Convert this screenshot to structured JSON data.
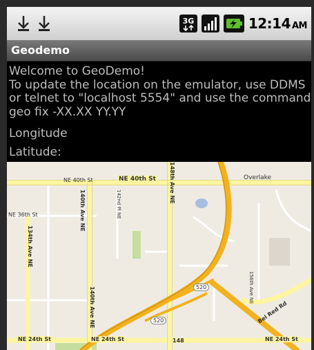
{
  "status_bar": {
    "time": "12:14",
    "ampm": "AM",
    "network_badge": "3G",
    "icons": [
      "download-icon",
      "download-icon",
      "network-3g-icon",
      "signal-icon",
      "battery-charging-icon"
    ]
  },
  "app": {
    "title": "Geodemo"
  },
  "content": {
    "welcome_line1": "Welcome to GeoDemo!",
    "welcome_line2": "To update the location on the emulator, use DDMS",
    "welcome_line3": "or telnet to \"localhost 5554\" and use the command",
    "welcome_line4": "geo fix -XX.XX YY.YY",
    "longitude_label": "Longitude",
    "latitude_label": "Latitude:"
  },
  "map": {
    "labels": {
      "ne40_left": "NE 40th St",
      "ne40_right": "NE 40th St",
      "ne36": "NE 36th St",
      "ave140_top": "140th Ave NE",
      "ave142": "142nd Pl NE",
      "ave148": "148th Ave NE",
      "ave134": "134th Ave NE",
      "ave140_bottom": "140th Ave NE",
      "ave156": "156th Ave NE",
      "overlake": "Overlake",
      "route_520_a": "520",
      "route_520_b": "520",
      "belred": "Bel Red Rd",
      "ne24_left": "NE 24th St",
      "ne24_mid": "NE 24th St",
      "ne24_right": "NE 24th St",
      "ave148_bottom": "148"
    },
    "colors": {
      "background": "#efebe3",
      "highway": "#f2b21f",
      "arterial": "#fdf5a0",
      "park": "#c5dea0",
      "water": "#a5bfdd"
    }
  }
}
